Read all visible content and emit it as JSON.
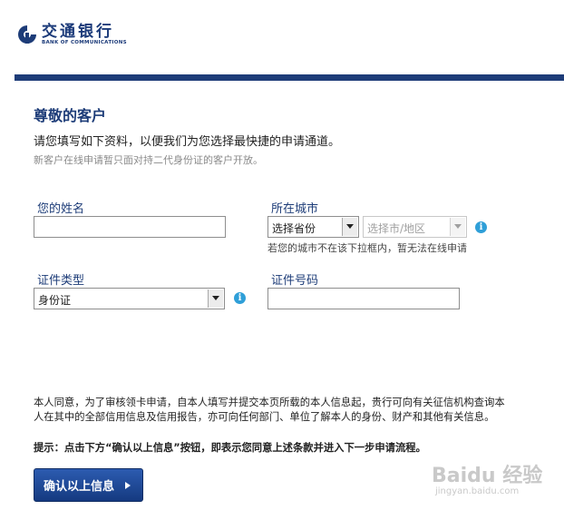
{
  "header": {
    "bank_name_cn": "交通银行",
    "bank_name_en": "BANK OF COMMUNICATIONS",
    "brand_color": "#1d3c78"
  },
  "intro": {
    "title": "尊敬的客户",
    "subtitle": "请您填写如下资料，以便我们为您选择最快捷的申请通道。",
    "note": "新客户在线申请暂只面对持二代身份证的客户开放。"
  },
  "form": {
    "name_label": "您的姓名",
    "name_value": "",
    "city_label": "所在城市",
    "province_select": "选择省份",
    "city_select": "选择市/地区",
    "city_hint": "若您的城市不在该下拉框内，暂无法在线申请",
    "id_type_label": "证件类型",
    "id_type_select": "身份证",
    "id_number_label": "证件号码",
    "id_number_value": ""
  },
  "consent": {
    "text": "本人同意，为了审核领卡申请，自本人填写并提交本页所载的本人信息起，贵行可向有关征信机构查询本人在其中的全部信用信息及信用报告，亦可向任何部门、单位了解本人的身份、财产和其他有关信息。",
    "tip": "提示：点击下方“确认以上信息”按钮，即表示您同意上述条款并进入下一步申请流程。"
  },
  "actions": {
    "confirm_label": "确认以上信息"
  },
  "watermark": {
    "brand": "Baidu 经验",
    "url": "jingyan.baidu.com"
  },
  "icons": {
    "info": "info-icon",
    "logo": "bocom-logo-icon"
  }
}
